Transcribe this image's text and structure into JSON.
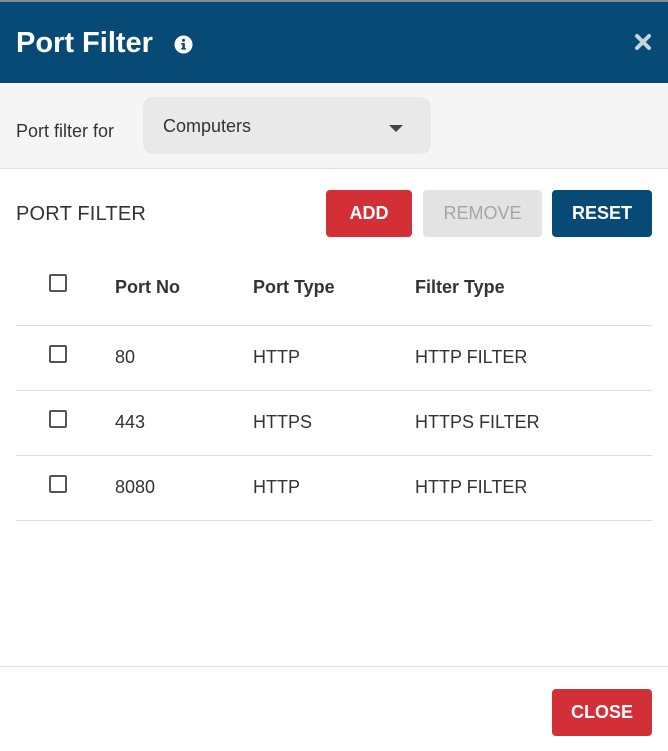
{
  "dialog": {
    "title": "Port Filter",
    "info_icon": "info-circle-icon",
    "close_icon": "close-x-icon"
  },
  "filter_for": {
    "label": "Port filter for",
    "selected": "Computers",
    "caret_icon": "caret-down-icon"
  },
  "section": {
    "title": "PORT FILTER"
  },
  "toolbar": {
    "add_label": "ADD",
    "remove_label": "REMOVE",
    "reset_label": "RESET"
  },
  "table": {
    "columns": [
      "Port No",
      "Port Type",
      "Filter Type"
    ],
    "rows": [
      {
        "port": "80",
        "type": "HTTP",
        "filter": "HTTP FILTER"
      },
      {
        "port": "443",
        "type": "HTTPS",
        "filter": "HTTPS FILTER"
      },
      {
        "port": "8080",
        "type": "HTTP",
        "filter": "HTTP FILTER"
      }
    ]
  },
  "footer": {
    "close_label": "CLOSE"
  },
  "colors": {
    "header_bg": "#064a75",
    "primary_blue": "#064a75",
    "danger_red": "#d32f36",
    "disabled_bg": "#e3e3e3"
  }
}
